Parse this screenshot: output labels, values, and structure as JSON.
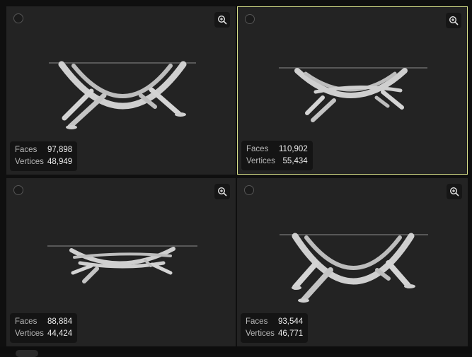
{
  "cards": [
    {
      "faces_label": "Faces",
      "faces": "97,898",
      "vertices_label": "Vertices",
      "vertices": "48,949"
    },
    {
      "faces_label": "Faces",
      "faces": "110,902",
      "vertices_label": "Vertices",
      "vertices": "55,434"
    },
    {
      "faces_label": "Faces",
      "faces": "88,884",
      "vertices_label": "Vertices",
      "vertices": "44,424"
    },
    {
      "faces_label": "Faces",
      "faces": "93,544",
      "vertices_label": "Vertices",
      "vertices": "46,771"
    }
  ],
  "icons": {
    "select": "radio-icon",
    "zoom": "zoom-in-icon"
  },
  "colors": {
    "card_bg": "#232323",
    "selected_border": "#d8e08a",
    "model": "#cfcfcf"
  }
}
